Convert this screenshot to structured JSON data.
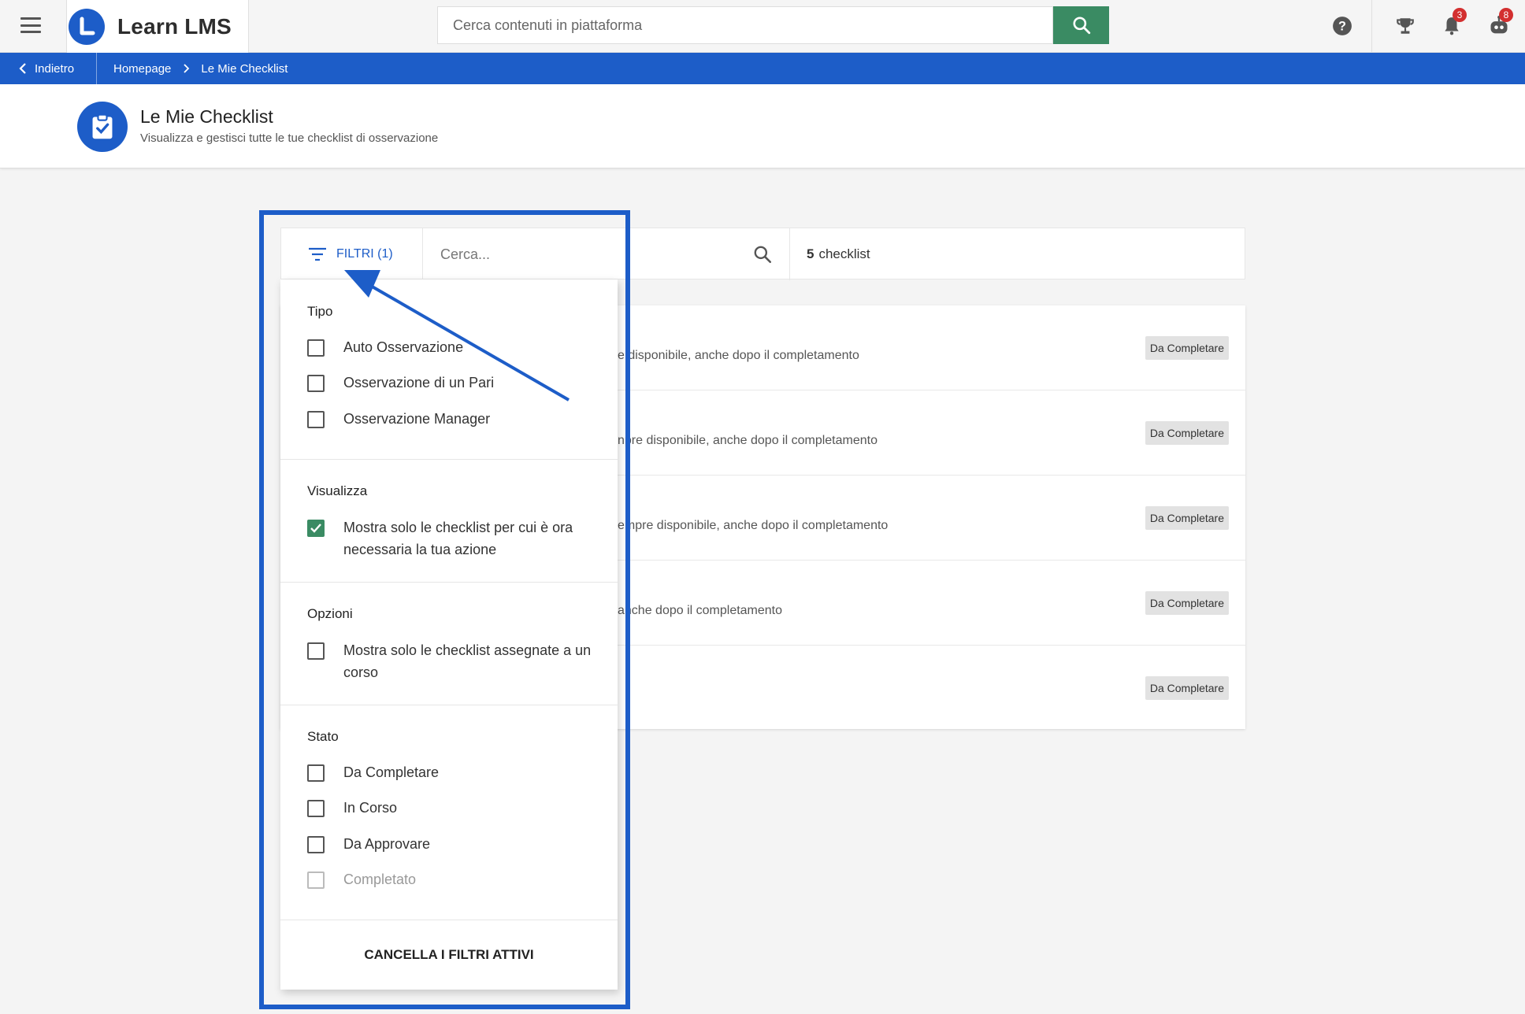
{
  "app": {
    "brand": "Learn LMS",
    "brand_color": "#1d5dc8",
    "accent_green": "#3a8b63"
  },
  "topbar": {
    "menu_icon": "hamburger-icon",
    "search_placeholder": "Cerca contenuti in piattaforma",
    "search_icon": "search-icon",
    "help_icon": "help-icon",
    "trophy_icon": "trophy-icon",
    "notifications": {
      "icon": "bell-icon",
      "count": "3"
    },
    "messages": {
      "icon": "robot-icon",
      "count": "8"
    }
  },
  "breadcrumb": {
    "back_label": "Indietro",
    "items": [
      "Homepage",
      "Le Mie Checklist"
    ]
  },
  "page": {
    "title": "Le Mie Checklist",
    "subtitle": "Visualizza e gestisci tutte le tue checklist di osservazione",
    "icon": "clipboard-check-icon"
  },
  "toolbar": {
    "filters_label": "FILTRI (1)",
    "search_placeholder": "Cerca...",
    "count_number": "5",
    "count_label": "checklist"
  },
  "list": {
    "rows": [
      {
        "desc": "e disponibile, anche dopo il completamento",
        "status": "Da Completare"
      },
      {
        "desc": "npre disponibile, anche dopo il completamento",
        "status": "Da Completare"
      },
      {
        "desc": "empre disponibile, anche dopo il completamento",
        "status": "Da Completare"
      },
      {
        "desc": "anche dopo il completamento",
        "status": "Da Completare"
      },
      {
        "desc": "",
        "status": "Da Completare"
      }
    ]
  },
  "filters": {
    "tipo": {
      "title": "Tipo",
      "options": [
        "Auto Osservazione",
        "Osservazione di un Pari",
        "Osservazione Manager"
      ]
    },
    "visualizza": {
      "title": "Visualizza",
      "option": "Mostra solo le checklist per cui è ora necessaria la tua azione",
      "checked": true
    },
    "opzioni": {
      "title": "Opzioni",
      "option": "Mostra solo le checklist assegnate a un corso",
      "checked": false
    },
    "stato": {
      "title": "Stato",
      "options": [
        "Da Completare",
        "In Corso",
        "Da Approvare",
        "Completato"
      ],
      "disabled": [
        "Completato"
      ]
    },
    "clear_label": "CANCELLA I FILTRI ATTIVI"
  }
}
